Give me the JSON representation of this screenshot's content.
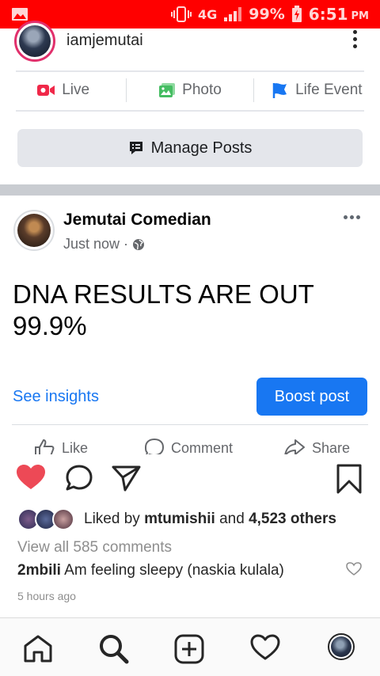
{
  "status_bar": {
    "network": "4G",
    "battery_percent": "99%",
    "time": "6:51",
    "ampm": "PM",
    "bg_color": "#ff0000"
  },
  "profile": {
    "username": "iamjemutai"
  },
  "composer": {
    "actions": [
      {
        "label": "Live",
        "icon": "live-video-icon",
        "color": "#f02849"
      },
      {
        "label": "Photo",
        "icon": "photo-icon",
        "color": "#45bd62"
      },
      {
        "label": "Life Event",
        "icon": "flag-icon",
        "color": "#1877f2"
      }
    ],
    "manage_posts_label": "Manage Posts"
  },
  "post": {
    "author": "Jemutai Comedian",
    "timestamp": "Just now",
    "privacy_icon": "globe-icon",
    "text_line1": "DNA RESULTS ARE OUT",
    "text_line2": "99.9%",
    "see_insights_label": "See insights",
    "boost_label": "Boost post",
    "reactions": {
      "like_label": "Like",
      "comment_label": "Comment",
      "share_label": "Share"
    }
  },
  "feed_item": {
    "liked_by_prefix": "Liked by",
    "liked_by_user": "mtumishii",
    "liked_by_and": "and",
    "liked_by_others": "4,523 others",
    "view_comments": "View all 585 comments",
    "comment": {
      "user": "2mbili",
      "text": "Am feeling sleepy (naskia kulala)"
    },
    "time_ago": "5 hours ago"
  },
  "bottom_nav": [
    "home-icon",
    "search-icon",
    "add-post-icon",
    "activity-heart-icon",
    "profile-avatar"
  ],
  "colors": {
    "accent_blue": "#1877f2",
    "heart_red": "#ed4956"
  }
}
